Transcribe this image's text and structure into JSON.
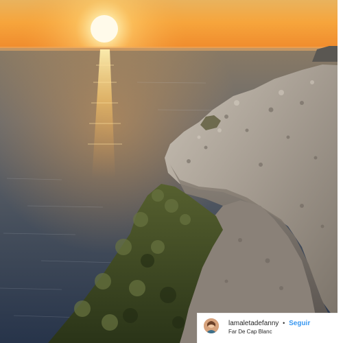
{
  "post": {
    "username": "lamaletadefanny",
    "separator": "•",
    "follow_label": "Seguir",
    "location": "Far De Cap Blanc"
  },
  "photo": {
    "subject": "sunset over the sea seen from a rocky cliff with shrubs",
    "colors": {
      "sky_top": "#f3b45a",
      "sky_mid": "#f7a23a",
      "sun": "#fff6cf",
      "sea_far": "#6a6d73",
      "sea_near": "#2e3a4c",
      "rock_light": "#b8b0a5",
      "rock_dark": "#6f675f",
      "shrub": "#3f4a25"
    }
  },
  "avatar": {
    "icon": "profile-photo-icon"
  }
}
